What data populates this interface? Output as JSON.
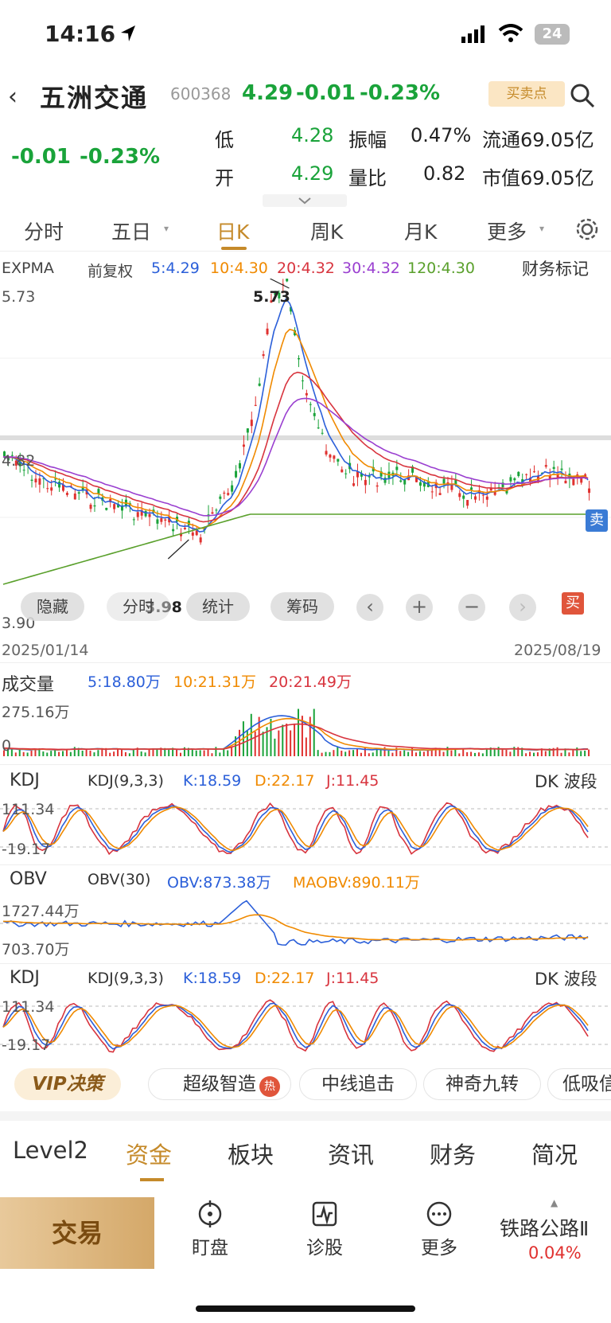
{
  "status_bar": {
    "time": "14:16",
    "battery": "24"
  },
  "header": {
    "back_icon": "chevron-left-icon",
    "name": "五洲交通",
    "code": "600368",
    "price": "4.29",
    "change": "-0.01",
    "change_pct": "-0.23%",
    "buy_sell_label": "买卖点"
  },
  "quote": {
    "big_price": "4.29",
    "change": "-0.01",
    "change_pct": "-0.23%",
    "low_label": "低",
    "low_value": "4.28",
    "amp_label": "振幅",
    "amp_value": "0.47%",
    "float_label": "流通",
    "float_value": "69.05亿",
    "open_label": "开",
    "open_value": "4.29",
    "vr_label": "量比",
    "vr_value": "0.82",
    "mcap_label": "市值",
    "mcap_value": "69.05亿"
  },
  "tabs": [
    "分时",
    "五日",
    "日K",
    "周K",
    "月K",
    "更多"
  ],
  "main_chart": {
    "indicator": "EXPMA",
    "adjust": "前复权",
    "ma5": "5:4.29",
    "ma10": "10:4.30",
    "ma20": "20:4.32",
    "ma30": "30:4.32",
    "ma120": "120:4.30",
    "finance_mark": "财务标记",
    "y_top": "5.73",
    "y_mid": "4.82",
    "y_bottom": "3.90",
    "high_label": "5.73",
    "low_label": "3.98",
    "date_start": "2025/01/14",
    "date_end": "2025/08/19",
    "sell_tag": "卖",
    "buy_tag": "买",
    "buttons": [
      "隐藏",
      "分时",
      "统计",
      "筹码"
    ]
  },
  "volume": {
    "title": "成交量",
    "ma5": "5:18.80万",
    "ma10": "10:21.31万",
    "ma20": "20:21.49万",
    "y_top": "275.16万",
    "y_zero": "0"
  },
  "kdj1": {
    "title": "KDJ",
    "params": "KDJ(9,3,3)",
    "k": "K:18.59",
    "d": "D:22.17",
    "j": "J:11.45",
    "band": "DK 波段",
    "y_top": "111.34",
    "y_bottom": "-19.17"
  },
  "obv": {
    "title": "OBV",
    "params": "OBV(30)",
    "obv": "OBV:873.38万",
    "maobv": "MAOBV:890.11万",
    "y_top": "1727.44万",
    "y_bottom": "703.70万"
  },
  "kdj2": {
    "title": "KDJ",
    "params": "KDJ(9,3,3)",
    "k": "K:18.59",
    "d": "D:22.17",
    "j": "J:11.45",
    "band": "DK 波段",
    "y_top": "111.34",
    "y_bottom": "-19.17"
  },
  "vip": {
    "label": "VIP决策",
    "chips": [
      "超级智造",
      "中线追击",
      "神奇九转",
      "低吸信"
    ]
  },
  "bottom_tabs": [
    "Level2",
    "资金",
    "板块",
    "资讯",
    "财务",
    "简况"
  ],
  "bottom_bar": {
    "trade": "交易",
    "watch": "盯盘",
    "diagnose": "诊股",
    "more": "更多",
    "sector": "铁路公路Ⅱ",
    "sector_pct": "0.04%"
  },
  "colors": {
    "up": "#e0312f",
    "down": "#1aa33a",
    "accent": "#c58a2a",
    "ma5": "#2b5fd9",
    "ma10": "#f08a00",
    "ma20": "#d8343e",
    "ma30": "#9a3fd0",
    "ma120": "#5aa02c"
  }
}
